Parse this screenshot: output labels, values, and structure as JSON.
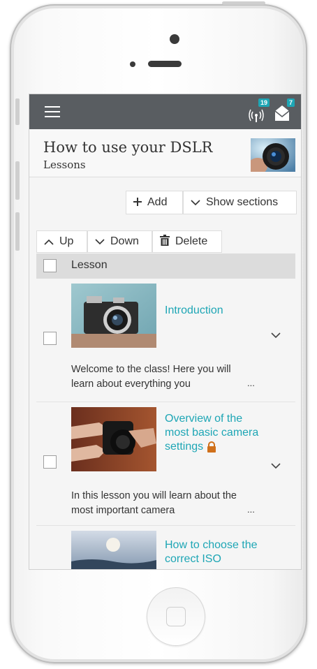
{
  "header": {
    "menu_icon": "hamburger-icon",
    "notifications": [
      {
        "icon": "antenna-icon",
        "count": "19"
      },
      {
        "icon": "envelope-icon",
        "count": "7"
      }
    ]
  },
  "course": {
    "title": "How to use your DSLR",
    "subtitle": "Lessons"
  },
  "toolbar": {
    "add_label": "Add",
    "show_sections_label": "Show sections",
    "up_label": "Up",
    "down_label": "Down",
    "delete_label": "Delete"
  },
  "table": {
    "column_header": "Lesson",
    "rows": [
      {
        "title": "Introduction",
        "description": "Welcome to the class! Here you will learn about everything you",
        "ellipsis": "...",
        "locked": false
      },
      {
        "title": "Overview of the most basic camera settings",
        "description": "In this lesson you will learn about the most important camera",
        "ellipsis": "...",
        "locked": true
      },
      {
        "title": "How to choose the correct ISO",
        "description": "",
        "ellipsis": "",
        "locked": true
      }
    ]
  },
  "colors": {
    "accent": "#1ea6b5",
    "topbar": "#595d61",
    "lock": "#d0701a"
  }
}
